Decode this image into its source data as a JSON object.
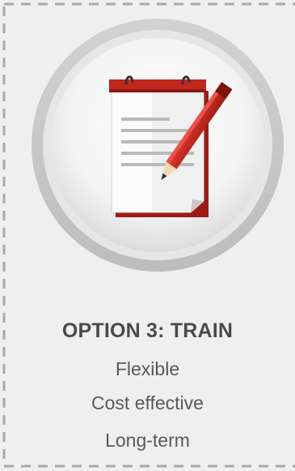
{
  "option": {
    "title": "OPTION 3: TRAIN",
    "features": [
      "Flexible",
      "Cost effective",
      "Long-term"
    ]
  },
  "icon": "notepad-with-pencil-icon",
  "colors": {
    "background": "#efefef",
    "border_dash": "#a9a9a9",
    "accent_red": "#c0271f",
    "title_text": "#4a4a4a",
    "feature_text": "#5a5a5a"
  }
}
